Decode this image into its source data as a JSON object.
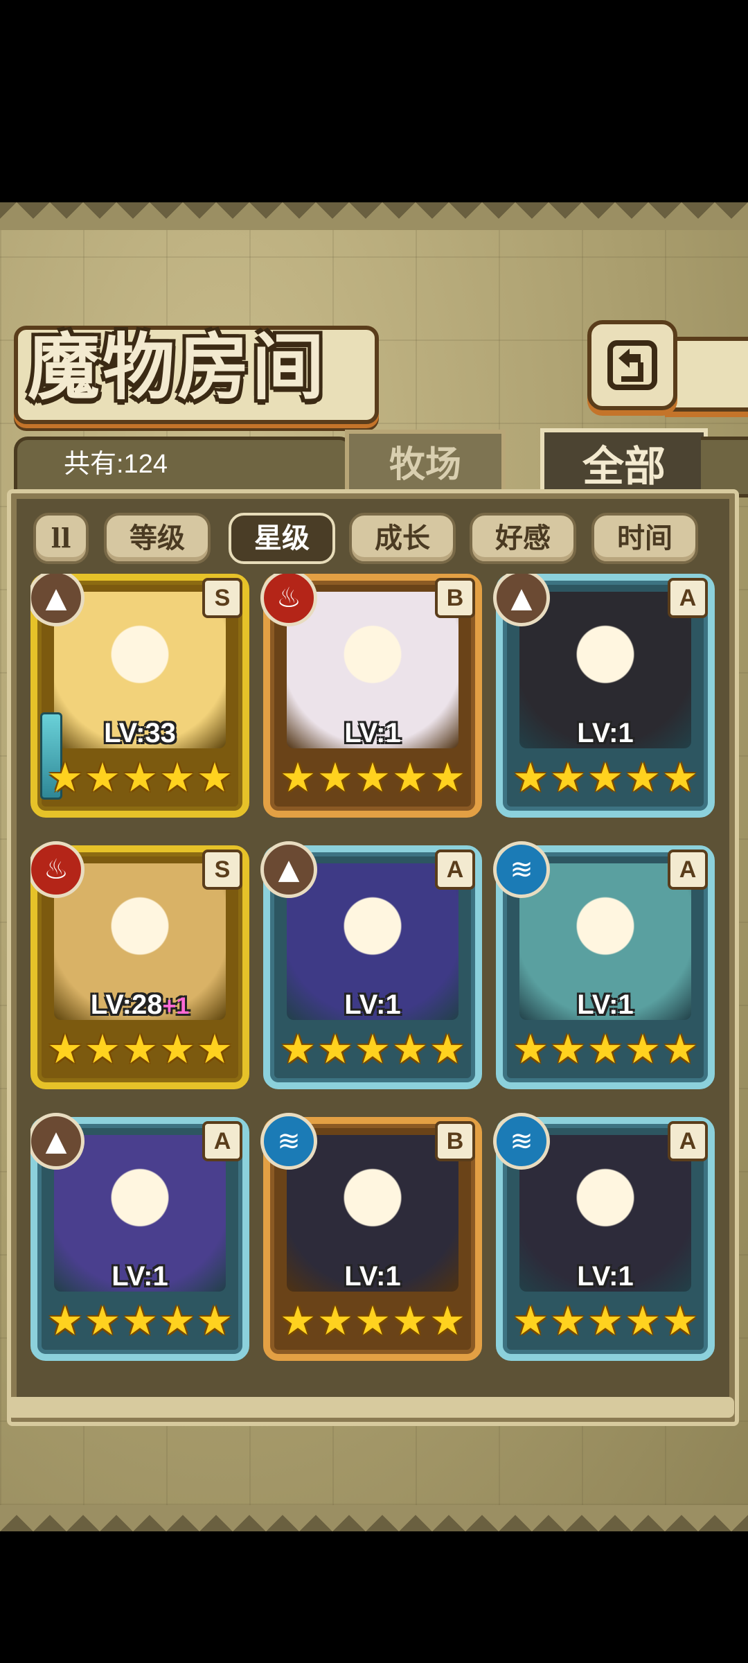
{
  "title": "魔物房间",
  "back_button": {
    "icon": "return-arrow-icon"
  },
  "count_label": "共有:124",
  "tabs": [
    {
      "label": "牧场",
      "active": false
    },
    {
      "label": "全部",
      "active": true
    }
  ],
  "filters": {
    "sort_icon": "ll",
    "items": [
      {
        "label": "等级",
        "active": false
      },
      {
        "label": "星级",
        "active": true
      },
      {
        "label": "成长",
        "active": false
      },
      {
        "label": "好感",
        "active": false
      },
      {
        "label": "时间",
        "active": false
      }
    ]
  },
  "cards": [
    {
      "frame": "gold",
      "element": "earth",
      "rank": "S",
      "level": "LV:33",
      "bonus": "",
      "stars": 5,
      "weapon": true,
      "portrait_color": "#f2d27a"
    },
    {
      "frame": "bronze",
      "element": "fire",
      "rank": "B",
      "level": "LV:1",
      "bonus": "",
      "stars": 5,
      "weapon": false,
      "portrait_color": "#ece3ea"
    },
    {
      "frame": "teal",
      "element": "earth",
      "rank": "A",
      "level": "LV:1",
      "bonus": "",
      "stars": 5,
      "weapon": false,
      "portrait_color": "#2b2a30"
    },
    {
      "frame": "gold",
      "element": "fire",
      "rank": "S",
      "level": "LV:28",
      "bonus": "+1",
      "stars": 5,
      "weapon": false,
      "portrait_color": "#d9b266"
    },
    {
      "frame": "teal",
      "element": "earth",
      "rank": "A",
      "level": "LV:1",
      "bonus": "",
      "stars": 5,
      "weapon": false,
      "portrait_color": "#3e3a86"
    },
    {
      "frame": "teal",
      "element": "water",
      "rank": "A",
      "level": "LV:1",
      "bonus": "",
      "stars": 5,
      "weapon": false,
      "portrait_color": "#5aa0a0"
    },
    {
      "frame": "teal",
      "element": "earth",
      "rank": "A",
      "level": "LV:1",
      "bonus": "",
      "stars": 5,
      "weapon": false,
      "portrait_color": "#4a3f8e"
    },
    {
      "frame": "bronze",
      "element": "water",
      "rank": "B",
      "level": "LV:1",
      "bonus": "",
      "stars": 5,
      "weapon": false,
      "portrait_color": "#2d2b3a"
    },
    {
      "frame": "teal",
      "element": "water",
      "rank": "A",
      "level": "LV:1",
      "bonus": "",
      "stars": 5,
      "weapon": false,
      "portrait_color": "#2d2b3a"
    }
  ],
  "element_icons": {
    "earth": "mountain-icon",
    "fire": "flame-icon",
    "water": "water-wave-icon"
  }
}
